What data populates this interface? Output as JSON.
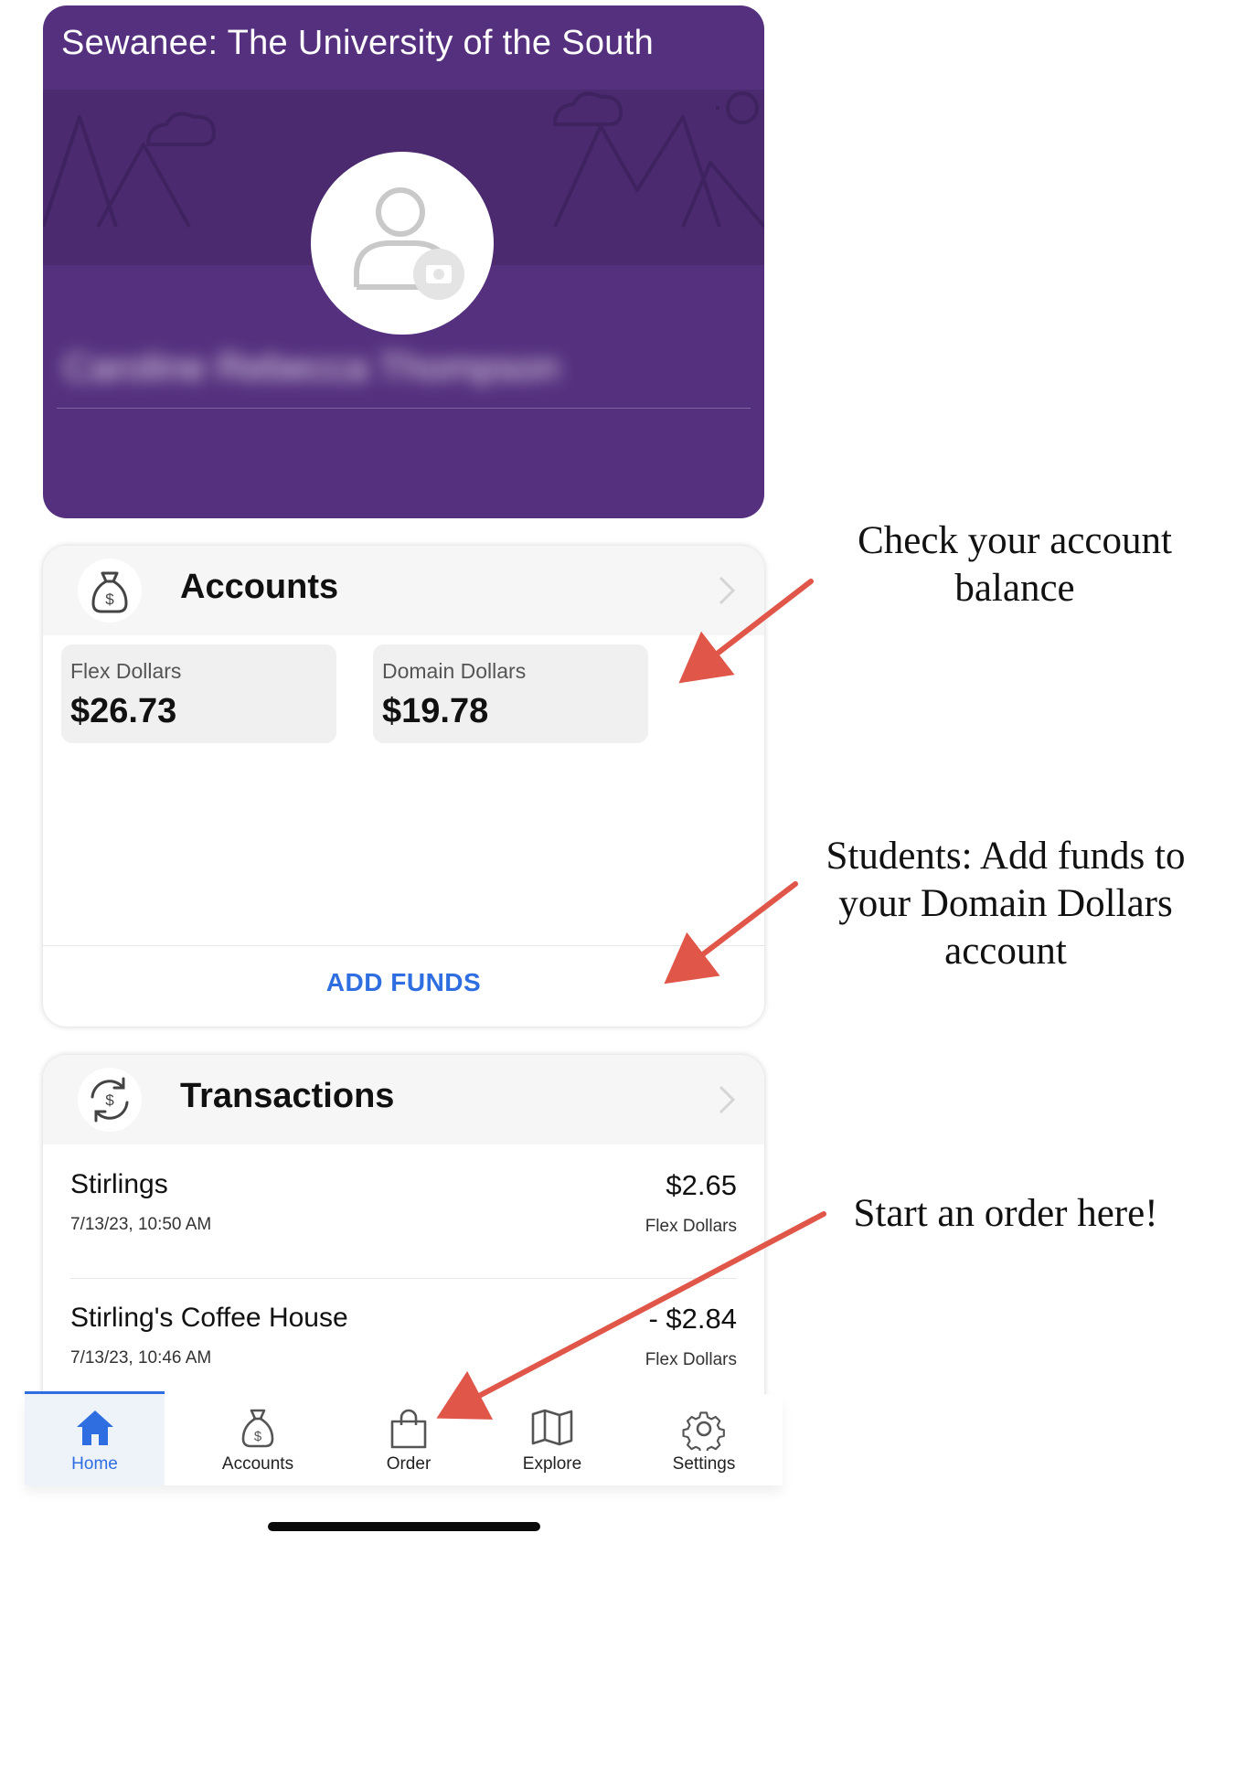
{
  "header": {
    "school_name": "Sewanee: The University of the South",
    "user_name_blurred": "Caroline Rebecca Thompson"
  },
  "accounts": {
    "title": "Accounts",
    "balances": [
      {
        "label": "Flex Dollars",
        "value": "$26.73"
      },
      {
        "label": "Domain Dollars",
        "value": "$19.78"
      }
    ],
    "add_funds_label": "ADD FUNDS"
  },
  "transactions": {
    "title": "Transactions",
    "items": [
      {
        "merchant": "Stirlings",
        "datetime": "7/13/23, 10:50 AM",
        "amount": "$2.65",
        "funding": "Flex Dollars"
      },
      {
        "merchant": "Stirling's Coffee House",
        "datetime": "7/13/23, 10:46 AM",
        "amount": "- $2.84",
        "funding": "Flex Dollars"
      }
    ]
  },
  "bottom_nav": {
    "active": "Home",
    "items": [
      {
        "label": "Home",
        "icon": "home-icon"
      },
      {
        "label": "Accounts",
        "icon": "money-bag-icon"
      },
      {
        "label": "Order",
        "icon": "shopping-bag-icon"
      },
      {
        "label": "Explore",
        "icon": "map-icon"
      },
      {
        "label": "Settings",
        "icon": "gear-icon"
      }
    ]
  },
  "annotations": {
    "note_1": "Check your account balance",
    "note_2": "Students: Add funds to your Domain Dollars account",
    "note_3": "Start an order here!"
  },
  "colors": {
    "header_purple": "#55307e",
    "banner_purple": "#4b2a6f",
    "accent_blue": "#2e6ee0",
    "arrow_red": "#e0574a"
  }
}
